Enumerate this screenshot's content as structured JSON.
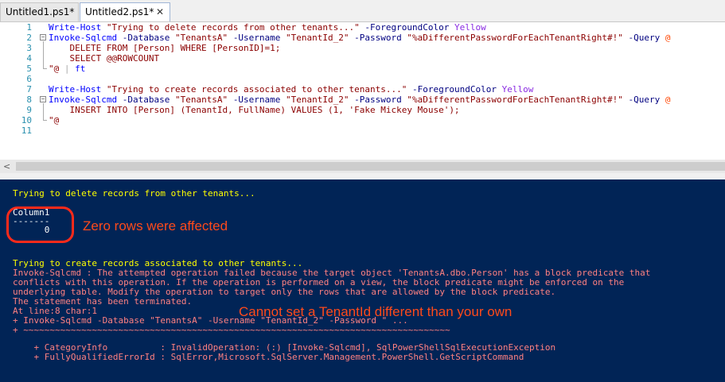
{
  "tabs": [
    {
      "label": "Untitled1.ps1*",
      "active": false
    },
    {
      "label": "Untitled2.ps1*",
      "active": true
    }
  ],
  "close_glyph": "✕",
  "editor": {
    "lines": [
      {
        "num": "1",
        "tokens": [
          [
            "cmd",
            "Write-Host"
          ],
          [
            "txt",
            " "
          ],
          [
            "str",
            "\"Trying to delete records from other tenants...\""
          ],
          [
            "txt",
            " "
          ],
          [
            "param",
            "-ForegroundColor"
          ],
          [
            "txt",
            " "
          ],
          [
            "yellow",
            "Yellow"
          ]
        ]
      },
      {
        "num": "2",
        "tokens": [
          [
            "cmd",
            "Invoke-Sqlcmd"
          ],
          [
            "txt",
            " "
          ],
          [
            "param",
            "-Database"
          ],
          [
            "txt",
            " "
          ],
          [
            "str",
            "\"TenantsA\""
          ],
          [
            "txt",
            " "
          ],
          [
            "param",
            "-Username"
          ],
          [
            "txt",
            " "
          ],
          [
            "str",
            "\"TenantId_2\""
          ],
          [
            "txt",
            " "
          ],
          [
            "param",
            "-Password"
          ],
          [
            "txt",
            " "
          ],
          [
            "str",
            "\"%aDifferentPasswordForEachTenantRight#!\""
          ],
          [
            "txt",
            " "
          ],
          [
            "param",
            "-Query"
          ],
          [
            "txt",
            " "
          ],
          [
            "var",
            "@"
          ]
        ]
      },
      {
        "num": "3",
        "tokens": [
          [
            "str",
            "    DELETE FROM [Person] WHERE [PersonID]=1;"
          ]
        ]
      },
      {
        "num": "4",
        "tokens": [
          [
            "str",
            "    SELECT @@ROWCOUNT"
          ]
        ]
      },
      {
        "num": "5",
        "tokens": [
          [
            "str",
            "\"@"
          ],
          [
            "txt",
            " "
          ],
          [
            "op",
            "|"
          ],
          [
            "txt",
            " "
          ],
          [
            "cmd",
            "ft"
          ]
        ]
      },
      {
        "num": "6",
        "tokens": []
      },
      {
        "num": "7",
        "tokens": [
          [
            "cmd",
            "Write-Host"
          ],
          [
            "txt",
            " "
          ],
          [
            "str",
            "\"Trying to create records associated to other tenants...\""
          ],
          [
            "txt",
            " "
          ],
          [
            "param",
            "-ForegroundColor"
          ],
          [
            "txt",
            " "
          ],
          [
            "yellow",
            "Yellow"
          ]
        ]
      },
      {
        "num": "8",
        "tokens": [
          [
            "cmd",
            "Invoke-Sqlcmd"
          ],
          [
            "txt",
            " "
          ],
          [
            "param",
            "-Database"
          ],
          [
            "txt",
            " "
          ],
          [
            "str",
            "\"TenantsA\""
          ],
          [
            "txt",
            " "
          ],
          [
            "param",
            "-Username"
          ],
          [
            "txt",
            " "
          ],
          [
            "str",
            "\"TenantId_2\""
          ],
          [
            "txt",
            " "
          ],
          [
            "param",
            "-Password"
          ],
          [
            "txt",
            " "
          ],
          [
            "str",
            "\"%aDifferentPasswordForEachTenantRight#!\""
          ],
          [
            "txt",
            " "
          ],
          [
            "param",
            "-Query"
          ],
          [
            "txt",
            " "
          ],
          [
            "var",
            "@"
          ]
        ]
      },
      {
        "num": "9",
        "tokens": [
          [
            "str",
            "    INSERT INTO [Person] (TenantId, FullName) VALUES (1, 'Fake Mickey Mouse');"
          ]
        ]
      },
      {
        "num": "10",
        "tokens": [
          [
            "str",
            "\"@"
          ]
        ]
      },
      {
        "num": "11",
        "tokens": []
      }
    ]
  },
  "scroll_left_glyph": "<",
  "console": {
    "lines": [
      {
        "text": "Trying to delete records from other tenants...",
        "color": "yellow"
      },
      {
        "text": "",
        "color": "white"
      },
      {
        "text": "Column1",
        "color": "white"
      },
      {
        "text": "-------",
        "color": "white"
      },
      {
        "text": "      0",
        "color": "white"
      },
      {
        "text": "",
        "color": "white"
      },
      {
        "text": "",
        "color": "white"
      },
      {
        "text": "Trying to create records associated to other tenants...",
        "color": "yellow"
      },
      {
        "text": "Invoke-Sqlcmd : The attempted operation failed because the target object 'TenantsA.dbo.Person' has a block predicate that",
        "color": "red"
      },
      {
        "text": "conflicts with this operation. If the operation is performed on a view, the block predicate might be enforced on the",
        "color": "red"
      },
      {
        "text": "underlying table. Modify the operation to target only the rows that are allowed by the block predicate.",
        "color": "red"
      },
      {
        "text": "The statement has been terminated.",
        "color": "red"
      },
      {
        "text": "At line:8 char:1",
        "color": "red"
      },
      {
        "text": "+ Invoke-Sqlcmd -Database \"TenantsA\" -Username \"TenantId_2\" -Password \" ...",
        "color": "red"
      },
      {
        "text": "+ ~~~~~~~~~~~~~~~~~~~~~~~~~~~~~~~~~~~~~~~~~~~~~~~~~~~~~~~~~~~~~~~~~~~~~~~~~~~~~~~~~",
        "color": "red"
      },
      {
        "text": "    + CategoryInfo          : InvalidOperation: (:) [Invoke-Sqlcmd], SqlPowerShellSqlExecutionException",
        "color": "red"
      },
      {
        "text": "    + FullyQualifiedErrorId : SqlError,Microsoft.SqlServer.Management.PowerShell.GetScriptCommand",
        "color": "red"
      }
    ]
  },
  "annotations": {
    "zero_rows": "Zero rows were affected",
    "tenant_id": "Cannot set a TenantId different than your own"
  },
  "colors": {
    "console_bg": "#012456",
    "annotation": "#ff4a1a"
  }
}
